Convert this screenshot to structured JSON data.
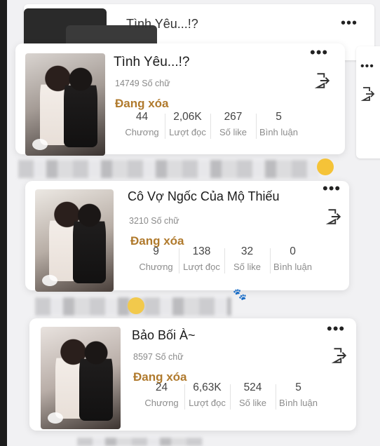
{
  "stories": [
    {
      "title": "Tình Yêu...!?",
      "words": "14749 Số chữ",
      "status": "Đang xóa",
      "stats": [
        {
          "value": "44",
          "label": "Chương"
        },
        {
          "value": "2,06K",
          "label": "Lượt đọc"
        },
        {
          "value": "267",
          "label": "Số like"
        },
        {
          "value": "5",
          "label": "Bình luận"
        }
      ]
    },
    {
      "title": "Cô Vợ Ngốc Của Mộ Thiếu",
      "words": "3210 Số chữ",
      "status": "Đang xóa",
      "stats": [
        {
          "value": "9",
          "label": "Chương"
        },
        {
          "value": "138",
          "label": "Lượt đọc"
        },
        {
          "value": "32",
          "label": "Số like"
        },
        {
          "value": "0",
          "label": "Bình luận"
        }
      ]
    },
    {
      "title": "Bảo Bối À~",
      "words": "8597 Số chữ",
      "status": "Đang xóa",
      "stats": [
        {
          "value": "24",
          "label": "Chương"
        },
        {
          "value": "6,63K",
          "label": "Lượt đọc"
        },
        {
          "value": "524",
          "label": "Số like"
        },
        {
          "value": "5",
          "label": "Bình luận"
        }
      ]
    }
  ],
  "background_ghost": {
    "title": "Tình Yêu...!?"
  },
  "more_icon_glyph": "•••",
  "icons": {
    "more": "more-dots-icon",
    "exit": "exit-door-icon",
    "cover_badge": "badge-icon"
  },
  "colors": {
    "status": "#b07a2d",
    "background": "#f1f1f3",
    "card": "#ffffff"
  }
}
